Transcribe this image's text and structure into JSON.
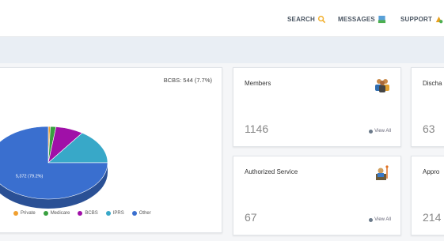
{
  "header": {
    "nav": [
      {
        "label": "SEARCH",
        "icon": "search-icon"
      },
      {
        "label": "MESSAGES",
        "icon": "messages-icon"
      },
      {
        "label": "SUPPORT",
        "icon": "support-icon"
      }
    ]
  },
  "chart_card": {
    "callout": "BCBS: 544 (7.7%)",
    "chart_data": {
      "type": "pie",
      "categories": [
        "Private",
        "Medicare",
        "BCBS",
        "IPRS",
        "Other"
      ],
      "values": [
        40,
        110,
        544,
        1096,
        5372
      ],
      "slice_label": "5,372 (79.2%)",
      "colors": [
        "#f0a030",
        "#3aa040",
        "#a010a8",
        "#38a8c8",
        "#3a6fcf"
      ],
      "legend_position": "bottom"
    }
  },
  "stats": [
    {
      "title": "Members",
      "value": "1146",
      "link": "View All",
      "icon": "members-icon"
    },
    {
      "title": "Discha",
      "value": "63"
    },
    {
      "title": "Authorized Service",
      "value": "67",
      "link": "View All",
      "icon": "authorized-service-icon"
    },
    {
      "title": "Appro",
      "value": "214"
    }
  ]
}
